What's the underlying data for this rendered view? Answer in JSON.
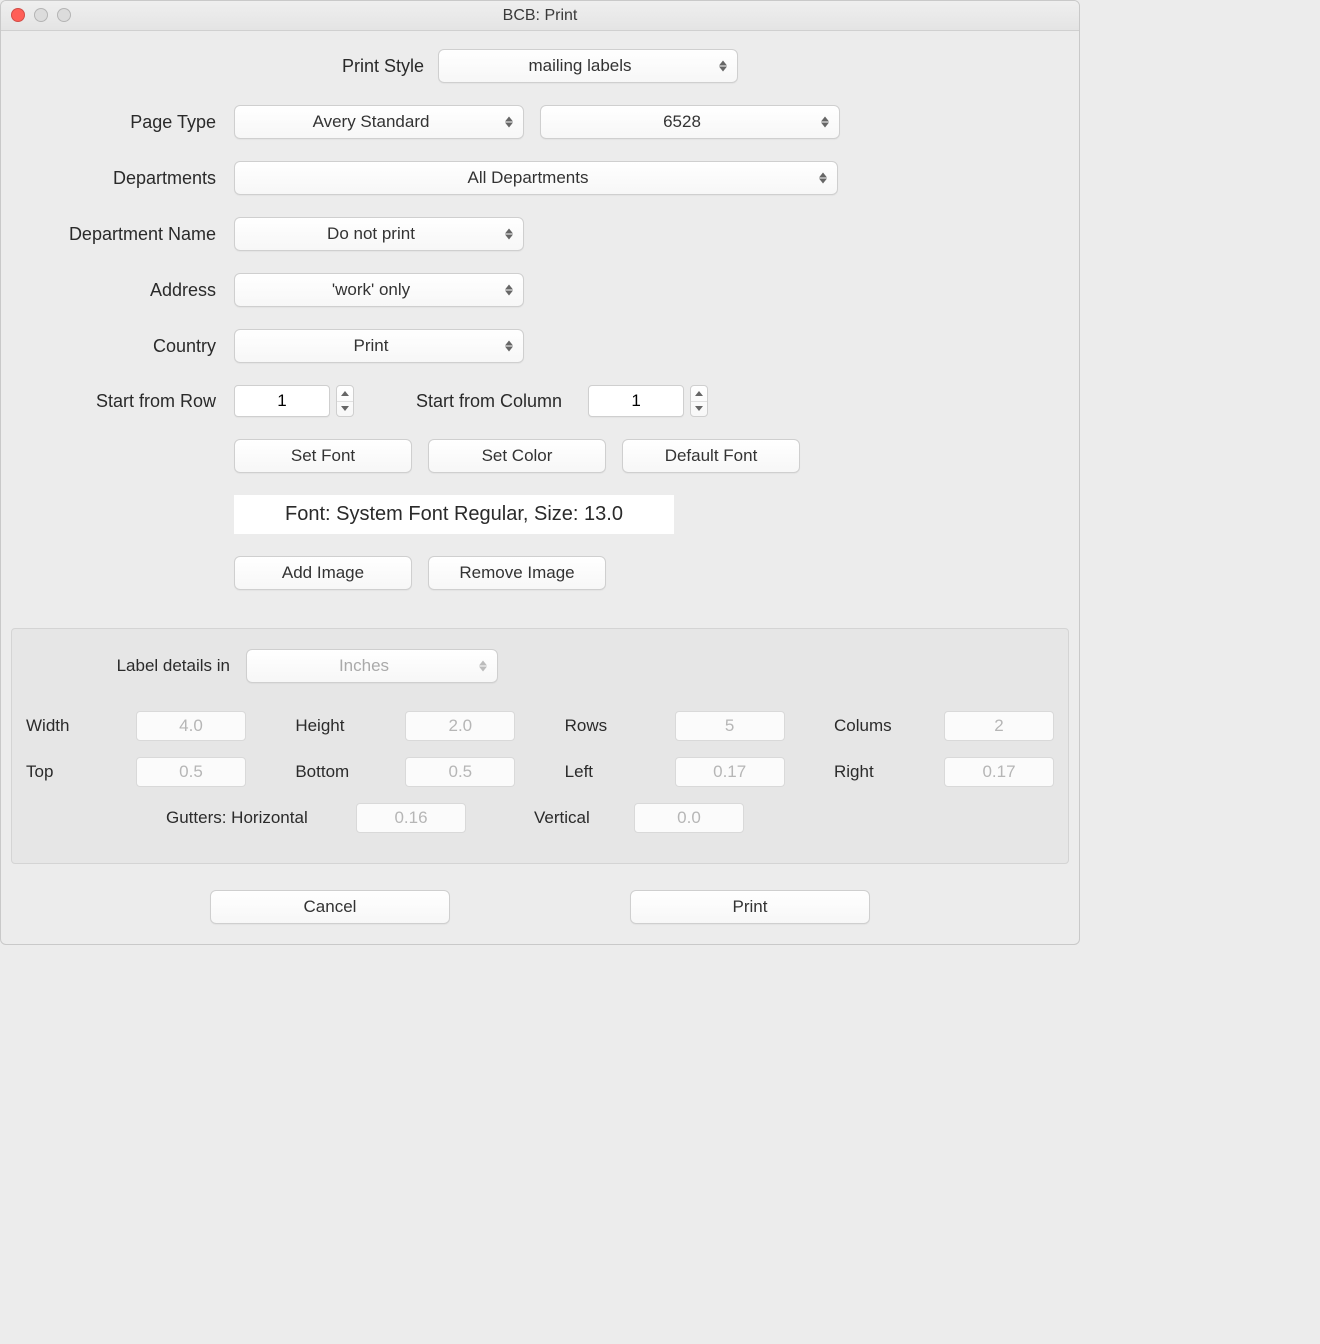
{
  "window": {
    "title": "BCB: Print"
  },
  "labels": {
    "print_style": "Print Style",
    "page_type": "Page Type",
    "departments": "Departments",
    "department_name": "Department Name",
    "address": "Address",
    "country": "Country",
    "start_row": "Start from Row",
    "start_col": "Start from Column",
    "label_details_in": "Label details in",
    "width": "Width",
    "height": "Height",
    "rows": "Rows",
    "cols": "Colums",
    "top": "Top",
    "bottom": "Bottom",
    "left": "Left",
    "right": "Right",
    "gutters_h": "Gutters: Horizontal",
    "gutters_v": "Vertical"
  },
  "values": {
    "print_style": "mailing labels",
    "page_type_vendor": "Avery Standard",
    "page_type_number": "6528",
    "departments": "All Departments",
    "department_name": "Do not print",
    "address": "'work' only",
    "country": "Print",
    "start_row": "1",
    "start_col": "1",
    "units": "Inches",
    "width": "4.0",
    "height": "2.0",
    "rows": "5",
    "cols": "2",
    "top": "0.5",
    "bottom": "0.5",
    "left": "0.17",
    "right": "0.17",
    "gutter_h": "0.16",
    "gutter_v": "0.0"
  },
  "buttons": {
    "set_font": "Set Font",
    "set_color": "Set Color",
    "default_font": "Default Font",
    "add_image": "Add Image",
    "remove_image": "Remove Image",
    "cancel": "Cancel",
    "print": "Print"
  },
  "font_display": "Font: System Font Regular, Size: 13.0"
}
